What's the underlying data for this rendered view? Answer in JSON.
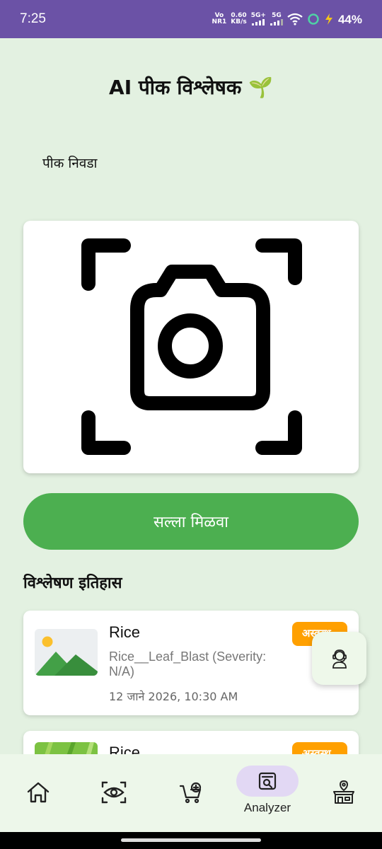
{
  "status_bar": {
    "time": "7:25",
    "volte": "Vo",
    "nr": "NR1",
    "speed": "0.60",
    "speed_unit": "KB/s",
    "net1": "5G+",
    "net2": "5G",
    "battery": "44%"
  },
  "header": {
    "title": "AI पीक विश्लेषक 🌱"
  },
  "crop_select": {
    "label": "पीक निवडा"
  },
  "camera_card": {
    "icon": "camera-scan-icon"
  },
  "advice_button": {
    "label": "सल्ला मिळवा",
    "color": "#4caf50"
  },
  "history": {
    "title": "विश्लेषण इतिहास",
    "items": [
      {
        "crop": "Rice",
        "disease": "Rice__Leaf_Blast (Severity: N/A)",
        "date": "12 जाने 2026, 10:30 AM",
        "badge": "अस्वस्थ",
        "badge_color": "#ffa000",
        "thumb": "image-placeholder-icon"
      },
      {
        "crop": "Rice",
        "badge": "अस्वस्थ",
        "badge_color": "#ffa000",
        "thumb": "rice-leaf-photo"
      }
    ]
  },
  "fab": {
    "icon": "support-agent-icon"
  },
  "bottom_nav": {
    "items": [
      {
        "icon": "home-icon",
        "label": ""
      },
      {
        "icon": "eye-scan-icon",
        "label": ""
      },
      {
        "icon": "cart-add-icon",
        "label": ""
      },
      {
        "icon": "analyzer-icon",
        "label": "Analyzer",
        "active": true
      },
      {
        "icon": "market-store-icon",
        "label": ""
      }
    ]
  },
  "colors": {
    "status_bar": "#6b52a6",
    "background": "#e3f1e1",
    "nav_active_pill": "#e2d8f4"
  }
}
